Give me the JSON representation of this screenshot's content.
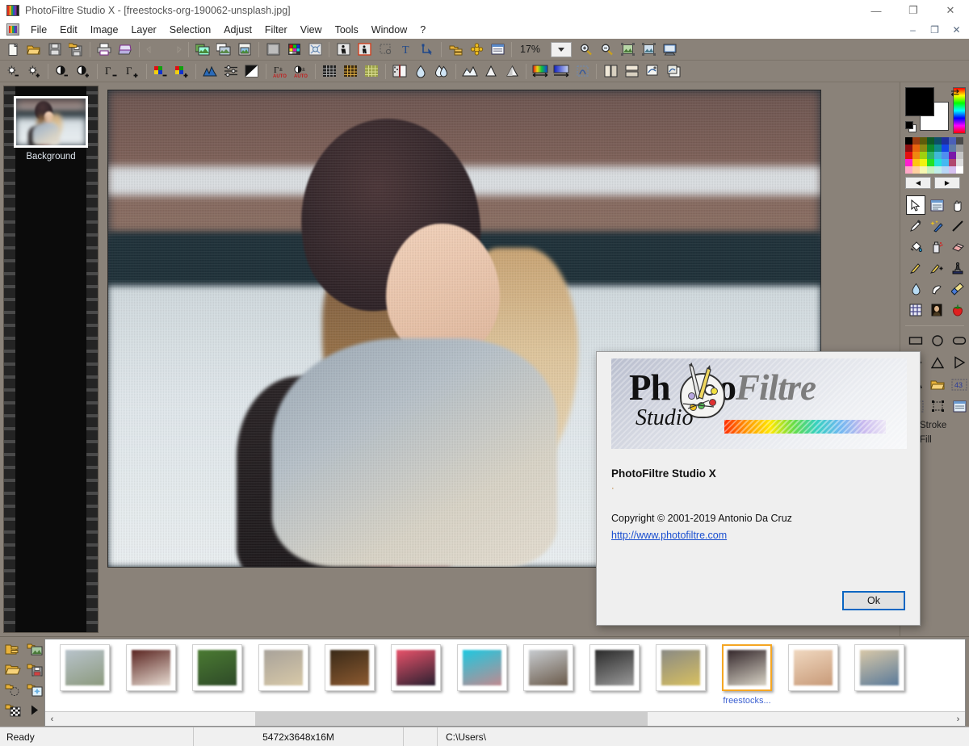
{
  "window": {
    "title": "PhotoFiltre Studio X - [freestocks-org-190062-unsplash.jpg]",
    "app_icon": "photofiltre-icon",
    "controls": {
      "minimize": "—",
      "maximize": "❐",
      "close": "✕"
    },
    "mdi_controls": {
      "minimize": "–",
      "restore": "❐",
      "close": "✕"
    }
  },
  "menu": {
    "items": [
      {
        "label": "File"
      },
      {
        "label": "Edit"
      },
      {
        "label": "Image"
      },
      {
        "label": "Layer"
      },
      {
        "label": "Selection"
      },
      {
        "label": "Adjust"
      },
      {
        "label": "Filter"
      },
      {
        "label": "View"
      },
      {
        "label": "Tools"
      },
      {
        "label": "Window"
      },
      {
        "label": "?"
      }
    ]
  },
  "toolbar_row1": {
    "zoom_value": "17%",
    "groups": [
      {
        "buttons": [
          {
            "name": "new-file-icon",
            "glyph": "page"
          },
          {
            "name": "open-file-icon",
            "glyph": "folder-open"
          },
          {
            "name": "save-icon",
            "glyph": "floppy"
          },
          {
            "name": "save-as-icon",
            "glyph": "floppy-folder"
          }
        ]
      },
      {
        "buttons": [
          {
            "name": "print-icon",
            "glyph": "printer"
          },
          {
            "name": "scanner-icon",
            "glyph": "scanner"
          }
        ]
      },
      {
        "buttons": [
          {
            "name": "undo-icon",
            "glyph": "undo"
          },
          {
            "name": "redo-icon",
            "glyph": "redo"
          }
        ]
      },
      {
        "buttons": [
          {
            "name": "copy-images-icon",
            "glyph": "images"
          },
          {
            "name": "batch-icon",
            "glyph": "images-stack"
          },
          {
            "name": "paste-image-icon",
            "glyph": "image-page"
          }
        ]
      },
      {
        "buttons": [
          {
            "name": "grayscale-icon",
            "glyph": "gray-square"
          },
          {
            "name": "color-mode-icon",
            "glyph": "color-grid"
          },
          {
            "name": "transparency-icon",
            "glyph": "transparent"
          }
        ]
      },
      {
        "buttons": [
          {
            "name": "cut-person-icon",
            "glyph": "person-cut"
          },
          {
            "name": "crop-person-icon",
            "glyph": "person-crop"
          },
          {
            "name": "marquee-icon",
            "glyph": "marquee"
          },
          {
            "name": "text-tool-icon",
            "glyph": "text-T"
          },
          {
            "name": "vector-select-icon",
            "glyph": "vector"
          }
        ]
      },
      {
        "buttons": [
          {
            "name": "layers-icon",
            "glyph": "layers-yellow"
          },
          {
            "name": "plugin-icon",
            "glyph": "gear-flower"
          },
          {
            "name": "panel-icon",
            "glyph": "panel"
          }
        ]
      }
    ],
    "zoom_buttons": [
      {
        "name": "zoom-dropdown",
        "glyph": "caret-down"
      },
      {
        "name": "zoom-in-icon",
        "glyph": "magnify-plus"
      },
      {
        "name": "zoom-out-icon",
        "glyph": "magnify-minus"
      },
      {
        "name": "fit-image-icon",
        "glyph": "image-fit"
      },
      {
        "name": "actual-size-icon",
        "glyph": "image-actual"
      },
      {
        "name": "fullscreen-icon",
        "glyph": "screen"
      }
    ]
  },
  "toolbar_row2": {
    "groups": [
      {
        "buttons": [
          {
            "name": "brightness-down-icon",
            "glyph": "sun-minus"
          },
          {
            "name": "brightness-up-icon",
            "glyph": "sun-plus"
          }
        ]
      },
      {
        "buttons": [
          {
            "name": "contrast-down-icon",
            "glyph": "contrast-minus"
          },
          {
            "name": "contrast-up-icon",
            "glyph": "contrast-plus"
          }
        ]
      },
      {
        "buttons": [
          {
            "name": "gamma-down-icon",
            "glyph": "gamma-minus"
          },
          {
            "name": "gamma-up-icon",
            "glyph": "gamma-plus"
          }
        ]
      },
      {
        "buttons": [
          {
            "name": "saturation-down-icon",
            "glyph": "rgb-minus"
          },
          {
            "name": "saturation-up-icon",
            "glyph": "rgb-plus"
          }
        ]
      },
      {
        "buttons": [
          {
            "name": "histogram-icon",
            "glyph": "histogram"
          },
          {
            "name": "levels-icon",
            "glyph": "sliders"
          },
          {
            "name": "auto-levels-icon",
            "glyph": "black-white"
          }
        ]
      },
      {
        "buttons": [
          {
            "name": "auto-gamma-icon",
            "glyph": "gamma-auto"
          },
          {
            "name": "auto-contrast-icon",
            "glyph": "contrast-auto"
          }
        ]
      },
      {
        "buttons": [
          {
            "name": "mosaic-icon",
            "glyph": "grid-dark"
          },
          {
            "name": "grid-icon",
            "glyph": "grid-amber"
          },
          {
            "name": "halftone-icon",
            "glyph": "grid-olive"
          }
        ]
      },
      {
        "buttons": [
          {
            "name": "mirror-icon",
            "glyph": "mirror"
          },
          {
            "name": "blur-icon",
            "glyph": "drop"
          },
          {
            "name": "blur-more-icon",
            "glyph": "drop-double"
          }
        ]
      },
      {
        "buttons": [
          {
            "name": "sharpen-icon",
            "glyph": "mountains"
          },
          {
            "name": "sharpen-more-icon",
            "glyph": "triangle"
          },
          {
            "name": "emboss-icon",
            "glyph": "triangle-shade"
          }
        ]
      },
      {
        "buttons": [
          {
            "name": "gradient-icon",
            "glyph": "gradient-rainbow"
          },
          {
            "name": "gradient-blue-icon",
            "glyph": "gradient-blue"
          },
          {
            "name": "deform-icon",
            "glyph": "deform"
          }
        ]
      },
      {
        "buttons": [
          {
            "name": "split-view-icon",
            "glyph": "split"
          },
          {
            "name": "stack-view-icon",
            "glyph": "stack"
          },
          {
            "name": "transform-icon",
            "glyph": "transform-a"
          },
          {
            "name": "transform2-icon",
            "glyph": "transform-b"
          }
        ]
      }
    ]
  },
  "layers_panel": {
    "layer_name": "Background"
  },
  "tool_palette": {
    "foreground_color": "#000000",
    "background_color": "#ffffff",
    "swap_icon": "swap-colors-icon",
    "hue_strip": "hue-gradient",
    "swatch_rows": [
      [
        "#000000",
        "#9c3b0f",
        "#5d5c0a",
        "#0e5a28",
        "#0d4f66",
        "#1f2f9e",
        "#4b5fb8",
        "#4a4a4a"
      ],
      [
        "#8c0e10",
        "#e8630d",
        "#8c8a12",
        "#0f8a2e",
        "#0e8a8a",
        "#1446e8",
        "#5f7ba8",
        "#9a9a9a"
      ],
      [
        "#e50f0f",
        "#f0870f",
        "#9fd10f",
        "#2eb56a",
        "#3fb8d8",
        "#4f8ef0",
        "#7a18a8",
        "#c6c6c6"
      ],
      [
        "#ff1fd0",
        "#ffc60f",
        "#f2f20f",
        "#24e024",
        "#24e0d8",
        "#46b8f2",
        "#b0486e",
        "#dcdcdc"
      ],
      [
        "#ffa8c8",
        "#ffd0a0",
        "#f6f6b0",
        "#c8f0c0",
        "#c0eee8",
        "#b8d6f6",
        "#d6c0f0",
        "#ffffff"
      ]
    ],
    "nav_prev": "◀",
    "nav_next": "▶",
    "tools": [
      {
        "name": "pointer-tool-icon",
        "glyph": "arrow",
        "active": true
      },
      {
        "name": "selection-tool-icon",
        "glyph": "selection"
      },
      {
        "name": "hand-tool-icon",
        "glyph": "hand"
      },
      {
        "name": "eyedropper-tool-icon",
        "glyph": "eyedropper"
      },
      {
        "name": "magic-wand-tool-icon",
        "glyph": "wand"
      },
      {
        "name": "line-tool-icon",
        "glyph": "line"
      },
      {
        "name": "paint-bucket-tool-icon",
        "glyph": "bucket"
      },
      {
        "name": "spray-tool-icon",
        "glyph": "spray"
      },
      {
        "name": "eraser-tool-icon",
        "glyph": "eraser"
      },
      {
        "name": "paintbrush-tool-icon",
        "glyph": "brush"
      },
      {
        "name": "brush-plus-tool-icon",
        "glyph": "brush-plus"
      },
      {
        "name": "stamp-tool-icon",
        "glyph": "stamp"
      },
      {
        "name": "waterdrop-tool-icon",
        "glyph": "waterdrop"
      },
      {
        "name": "smudge-tool-icon",
        "glyph": "smudge"
      },
      {
        "name": "clean-brush-tool-icon",
        "glyph": "broom"
      },
      {
        "name": "pattern-tool-icon",
        "glyph": "pattern"
      },
      {
        "name": "portrait-tool-icon",
        "glyph": "portrait"
      },
      {
        "name": "strawberry-tool-icon",
        "glyph": "strawberry"
      }
    ],
    "shapes": [
      {
        "name": "rectangle-shape-icon",
        "glyph": "rect"
      },
      {
        "name": "ellipse-shape-icon",
        "glyph": "circle"
      },
      {
        "name": "rounded-rect-shape-icon",
        "glyph": "round-rect"
      },
      {
        "name": "diamond-shape-icon",
        "glyph": "diamond"
      },
      {
        "name": "triangle-shape-icon",
        "glyph": "triangle"
      },
      {
        "name": "arrow-shape-icon",
        "glyph": "play-triangle"
      },
      {
        "name": "polygon-shape-icon",
        "glyph": "polygon"
      },
      {
        "name": "open-shape-icon",
        "glyph": "folder"
      },
      {
        "name": "count-43-icon",
        "glyph": "num43"
      },
      {
        "name": "count-32-icon",
        "glyph": "num32"
      },
      {
        "name": "transform-shape-icon",
        "glyph": "transform"
      },
      {
        "name": "shape-options-icon",
        "glyph": "panel"
      }
    ],
    "stroke_label": "Stroke",
    "fill_label": "Fill"
  },
  "browser": {
    "side_tools": [
      {
        "name": "browse-folder-icon",
        "glyph": "folder-list"
      },
      {
        "name": "folder-image-icon",
        "glyph": "folder-image"
      },
      {
        "name": "folder-open-icon",
        "glyph": "folder-open"
      },
      {
        "name": "folder-save-icon",
        "glyph": "folder-save"
      },
      {
        "name": "folder-select-icon",
        "glyph": "folder-select"
      },
      {
        "name": "folder-effect-icon",
        "glyph": "folder-effect"
      },
      {
        "name": "folder-checker-icon",
        "glyph": "folder-checker"
      },
      {
        "name": "play-icon",
        "glyph": "play"
      }
    ],
    "thumbnails": [
      {
        "name": "thumb-1",
        "label": "",
        "selected": false,
        "c1": "#b8c3cb",
        "c2": "#8c9a7e"
      },
      {
        "name": "thumb-2",
        "label": "",
        "selected": false,
        "c1": "#5a2420",
        "c2": "#e8dcd2"
      },
      {
        "name": "thumb-3",
        "label": "",
        "selected": false,
        "c1": "#4a7a32",
        "c2": "#2e4a28"
      },
      {
        "name": "thumb-4",
        "label": "",
        "selected": false,
        "c1": "#a8a29a",
        "c2": "#d8c9a8"
      },
      {
        "name": "thumb-5",
        "label": "",
        "selected": false,
        "c1": "#3a2a18",
        "c2": "#8c5a30"
      },
      {
        "name": "thumb-6",
        "label": "",
        "selected": false,
        "c1": "#e8526a",
        "c2": "#2a2030"
      },
      {
        "name": "thumb-7",
        "label": "",
        "selected": false,
        "c1": "#1ec8e0",
        "c2": "#c08a90"
      },
      {
        "name": "thumb-8",
        "label": "",
        "selected": false,
        "c1": "#c8ccd0",
        "c2": "#6a5a4a"
      },
      {
        "name": "thumb-9",
        "label": "",
        "selected": false,
        "c1": "#2a2a2a",
        "c2": "#9a9a9a"
      },
      {
        "name": "thumb-10",
        "label": "",
        "selected": false,
        "c1": "#8a8a84",
        "c2": "#d8c060"
      },
      {
        "name": "thumb-11",
        "label": "freestocks...",
        "selected": true,
        "c1": "#33262a",
        "c2": "#d8d3c6"
      },
      {
        "name": "thumb-12",
        "label": "",
        "selected": false,
        "c1": "#f0d8c0",
        "c2": "#c89a78"
      },
      {
        "name": "thumb-13",
        "label": "",
        "selected": false,
        "c1": "#d8c8a8",
        "c2": "#5a7a9a"
      }
    ],
    "scroll_left": "‹",
    "scroll_right": "›"
  },
  "statusbar": {
    "status": "Ready",
    "dimensions": "5472x3648x16M",
    "middle": "",
    "path": "C:\\Users\\"
  },
  "about_dialog": {
    "logo_ph": "Ph",
    "logo_to": "to",
    "logo_filtre": "Filtre",
    "logo_studio": "Studio",
    "product_name": "PhotoFiltre Studio X",
    "version": "·",
    "copyright": "Copyright © 2001-2019  Antonio Da Cruz",
    "website": "http://www.photofiltre.com",
    "ok_label": "Ok"
  },
  "colors": {
    "chrome": "#8a8279",
    "accent": "#0a66c2",
    "link": "#1a4fd0",
    "selection": "#f5a623"
  }
}
